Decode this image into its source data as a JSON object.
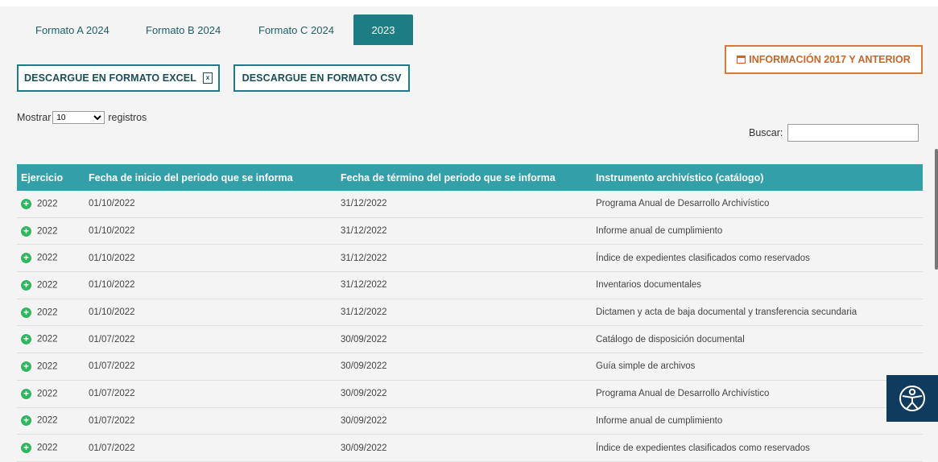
{
  "tabs": [
    "Formato A 2024",
    "Formato B 2024",
    "Formato C 2024",
    "2023"
  ],
  "buttons": {
    "excel": "DESCARGUE EN FORMATO EXCEL",
    "csv": "DESCARGUE EN FORMATO CSV",
    "info": "INFORMACIÓN 2017 Y ANTERIOR"
  },
  "length": {
    "prefix": "Mostrar",
    "value": "10",
    "suffix": "registros"
  },
  "search": {
    "label": "Buscar:",
    "value": ""
  },
  "table": {
    "headers": [
      "Ejercicio",
      "Fecha de inicio del periodo que se informa",
      "Fecha de término del periodo que se informa",
      "Instrumento archivístico (catálogo)"
    ],
    "rows": [
      [
        "2022",
        "01/10/2022",
        "31/12/2022",
        "Programa Anual de Desarrollo Archivístico"
      ],
      [
        "2022",
        "01/10/2022",
        "31/12/2022",
        "Informe anual de cumplimiento"
      ],
      [
        "2022",
        "01/10/2022",
        "31/12/2022",
        "Índice de expedientes clasificados como reservados"
      ],
      [
        "2022",
        "01/10/2022",
        "31/12/2022",
        "Inventarios documentales"
      ],
      [
        "2022",
        "01/10/2022",
        "31/12/2022",
        "Dictamen y acta de baja documental y transferencia secundaria"
      ],
      [
        "2022",
        "01/07/2022",
        "30/09/2022",
        "Catálogo de disposición documental"
      ],
      [
        "2022",
        "01/07/2022",
        "30/09/2022",
        "Guía simple de archivos"
      ],
      [
        "2022",
        "01/07/2022",
        "30/09/2022",
        "Programa Anual de Desarrollo Archivístico"
      ],
      [
        "2022",
        "01/07/2022",
        "30/09/2022",
        "Informe anual de cumplimiento"
      ],
      [
        "2022",
        "01/07/2022",
        "30/09/2022",
        "Índice de expedientes clasificados como reservados"
      ]
    ]
  },
  "colors": {
    "teal": "#1d7d85",
    "header": "#33a0a9",
    "orange": "#c8652a",
    "green": "#2eb85c",
    "navy": "#0f3b5f"
  },
  "icons": {
    "excel": "excel-file-icon",
    "info": "calendar-icon",
    "row": "expand-plus-icon",
    "a11y": "accessibility-icon"
  }
}
